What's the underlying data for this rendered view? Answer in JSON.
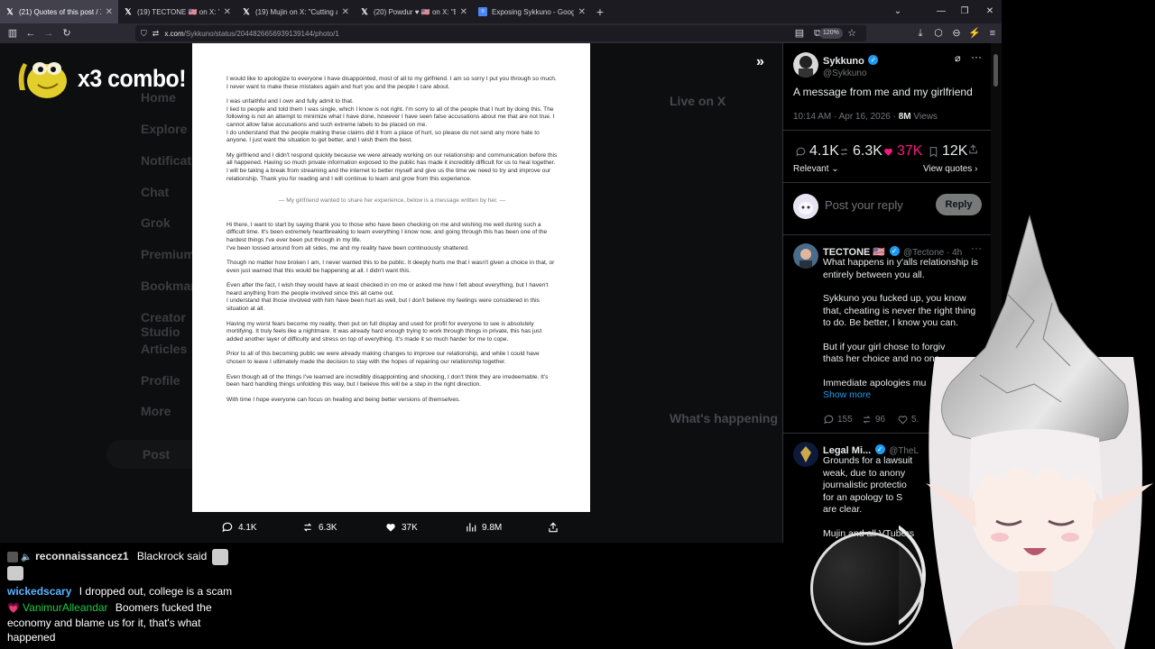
{
  "tabs": [
    {
      "title": "(21) Quotes of this post / X",
      "icon": "x-logo-icon",
      "active": true
    },
    {
      "title": "(19) TECTONE 🇺🇸 on X: \"Cutting",
      "icon": "x-logo-icon"
    },
    {
      "title": "(19) Mujin on X: \"Cutting all ti",
      "icon": "x-logo-icon"
    },
    {
      "title": "(20) Powdur ♥ 🇺🇸 on X: \"Bao,",
      "icon": "x-logo-icon"
    },
    {
      "title": "Exposing Sykkuno - Google Do",
      "icon": "google-docs-icon"
    }
  ],
  "browser": {
    "url_domain": "x.com",
    "url_path": "/Sykkuno/status/2044826656939139144/photo/1",
    "zoom": "120%"
  },
  "overlay": {
    "combo": "x3 combo!"
  },
  "backdrop": {
    "nav": [
      "Home",
      "Explore",
      "Notifications",
      "Chat",
      "Grok",
      "Premium",
      "Bookmarks",
      "Creator Studio",
      "Articles",
      "Profile",
      "More",
      "Post"
    ],
    "right_heading": "Live on X",
    "right_heading2": "What's happening"
  },
  "document": {
    "paragraphs": [
      "I would like to apologize to everyone I have disappointed, most of all to my girlfriend. I am so sorry I put you through so much. I never want to make these mistakes again and hurt you and the people I care about.",
      "I was unfaithful and I own and fully admit to that.\nI lied to people and told them I was single, which I know is not right. I'm sorry to all of the people that I hurt by doing this. The following is not an attempt to minimize what I have done, however I have seen false accusations about me that are not true. I cannot allow false accusations and such extreme labels to be placed on me.\nI do understand that the people making these claims did it from a place of hurt, so please do not send any more hate to anyone. I just want the situation to get better, and I wish them the best.",
      "My girlfriend and I didn't respond quickly because we were already working on our relationship and communication before this all happened. Having so much private information exposed to the public has made it incredibly difficult for us to heal together.\nI will be taking a break from streaming and the internet to better myself and give us the time we need to try and improve our relationship. Thank you for reading and I will continue to learn and grow from this experience."
    ],
    "separator": "— My girlfriend wanted to share her experience, below is a message written by her. —",
    "paragraphs2": [
      "Hi there, I want to start by saying thank you to those who have been checking on me and wishing me well during such a difficult time. It's been extremely heartbreaking to learn everything I know now, and going through this has been one of the hardest things I've ever been put through in my life.\nI've been tossed around from all sides, me and my reality have been continuously shattered.",
      "Though no matter how broken I am, I never wanted this to be public. It deeply hurts me that I wasn't given a choice in that, or even just warned that this would be happening at all. I didn't want this.",
      "Even after the fact, I wish they would have at least checked in on me or asked me how I felt about everything, but I haven't heard anything from the people involved since this all came out.\nI understand that those involved with him have been hurt as well, but I don't believe my feelings were considered in this situation at all.",
      "Having my worst fears become my reality, then put on full display and used for profit for everyone to see is absolutely mortifying. It truly feels like a nightmare. It was already hard enough trying to work through things in private, this has just added another layer of difficulty and stress on top of everything. It's made it so much harder for me to cope.",
      "Prior to all of this becoming public we were already making changes to improve our relationship, and while I could have chosen to leave I ultimately made the decision to stay with the hopes of repairing our relationship together.",
      "Even though all of the things I've learned are incredibly disappointing and shocking, I don't think they are irredeemable. It's been hard handling things unfolding this way, but I believe this will be a step in the right direction.",
      "With time I hope everyone can focus on healing and being better versions of themselves."
    ]
  },
  "photo_actions": {
    "replies": "4.1K",
    "reposts": "6.3K",
    "likes": "37K",
    "views": "9.8M"
  },
  "post": {
    "name": "Sykkuno",
    "handle": "@Sykkuno",
    "text": "A message from me and my girlfriend",
    "time": "10:14 AM · Apr 16, 2026 · ",
    "views_num": "8M",
    "views_label": " Views",
    "replies": "4.1K",
    "reposts": "6.3K",
    "likes": "37K",
    "bookmarks": "12K",
    "relevant": "Relevant",
    "view_quotes": "View quotes",
    "reply_placeholder": "Post your reply",
    "reply_button": "Reply"
  },
  "replies": [
    {
      "name": "TECTONE 🇺🇸",
      "handle": "@Tectone · 4h",
      "lines": [
        "What happens in y'alls relationship is entirely between you all.",
        "Sykkuno you fucked up, you know that, cheating is never the right thing to do. Be better, I know you can.",
        "But if your girl chose to forgiv",
        "thats her choice and no one",
        "Immediate apologies mu"
      ],
      "show_more": "Show more",
      "replies": "155",
      "reposts": "96",
      "likes": "5."
    },
    {
      "name": "Legal Mi...",
      "handle": "@TheL",
      "lines": [
        "Grounds for a lawsuit",
        "weak, due to anony",
        "journalistic protectio",
        "for an apology to S",
        "are clear.",
        "Mujin and all VTubers"
      ]
    }
  ],
  "chat": [
    {
      "user": "reconnaissancez1",
      "message": "Blackrock said",
      "color": "#e6e6e6"
    },
    {
      "user": "wickedscary",
      "message": "I dropped out, college is a scam",
      "color": "#5ab4ff"
    },
    {
      "user": "VanimurAlleandar",
      "message": "Boomers fucked the economy and blame us for it, that's what happened",
      "color": "#1ec948"
    }
  ]
}
